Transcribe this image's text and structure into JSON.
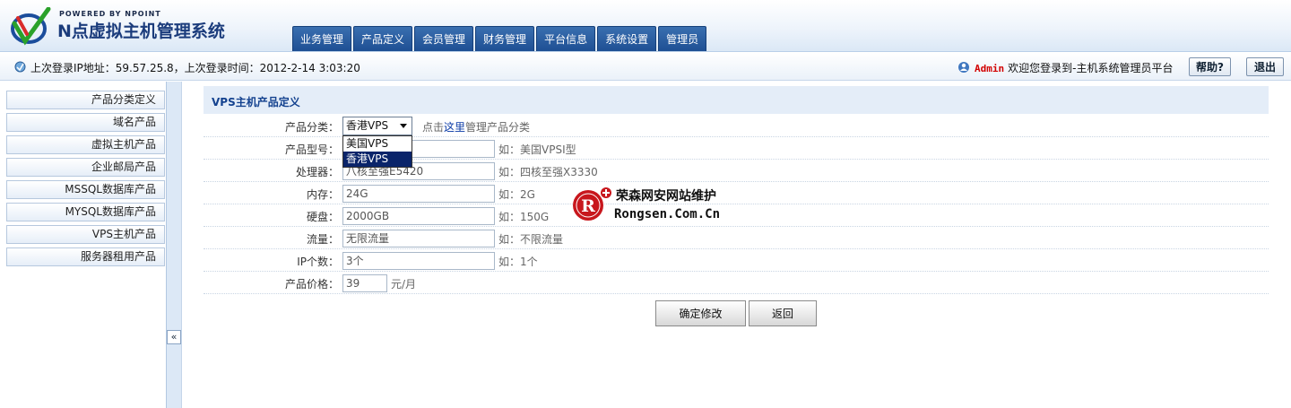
{
  "header": {
    "powered_by": "POWERED BY NPOINT",
    "app_title": "N点虚拟主机管理系统",
    "nav": [
      "业务管理",
      "产品定义",
      "会员管理",
      "财务管理",
      "平台信息",
      "系统设置",
      "管理员"
    ]
  },
  "infobar": {
    "last_login": "上次登录IP地址：59.57.25.8，上次登录时间：2012-2-14 3:03:20",
    "user": "Admin",
    "welcome": "欢迎您登录到-主机系统管理员平台",
    "help_label": "帮助?",
    "logout_label": "退出"
  },
  "sidebar": {
    "items": [
      "产品分类定义",
      "域名产品",
      "虚拟主机产品",
      "企业邮局产品",
      "MSSQL数据库产品",
      "MYSQL数据库产品",
      "VPS主机产品",
      "服务器租用产品"
    ],
    "collapse_label": "«"
  },
  "form": {
    "title": "VPS主机产品定义",
    "category": {
      "label": "产品分类：",
      "selected": "香港VPS",
      "options": [
        "美国VPS",
        "香港VPS"
      ],
      "hint_prefix": "点击",
      "hint_link": "这里",
      "hint_suffix": "管理产品分类"
    },
    "model": {
      "label": "产品型号：",
      "value": "",
      "hint": "如：美国VPSⅠ型"
    },
    "cpu": {
      "label": "处理器：",
      "value": "八核至强E5420",
      "hint": "如：四核至强X3330"
    },
    "memory": {
      "label": "内存：",
      "value": "24G",
      "hint": "如：2G"
    },
    "disk": {
      "label": "硬盘：",
      "value": "2000GB",
      "hint": "如：150G"
    },
    "traffic": {
      "label": "流量：",
      "value": "无限流量",
      "hint": "如：不限流量"
    },
    "ip_count": {
      "label": "IP个数：",
      "value": "3个",
      "hint": "如：1个"
    },
    "price": {
      "label": "产品价格：",
      "value": "39",
      "unit": "元/月"
    },
    "confirm_label": "确定修改",
    "back_label": "返回"
  },
  "watermark": {
    "line1": "荣森网安网站维护",
    "line2": "Rongsen.Com.Cn"
  },
  "colors": {
    "nav_bg": "#2a5ea4",
    "panel_head": "#e4edf8",
    "title_blue": "#14428f",
    "admin_red": "#d20000"
  }
}
